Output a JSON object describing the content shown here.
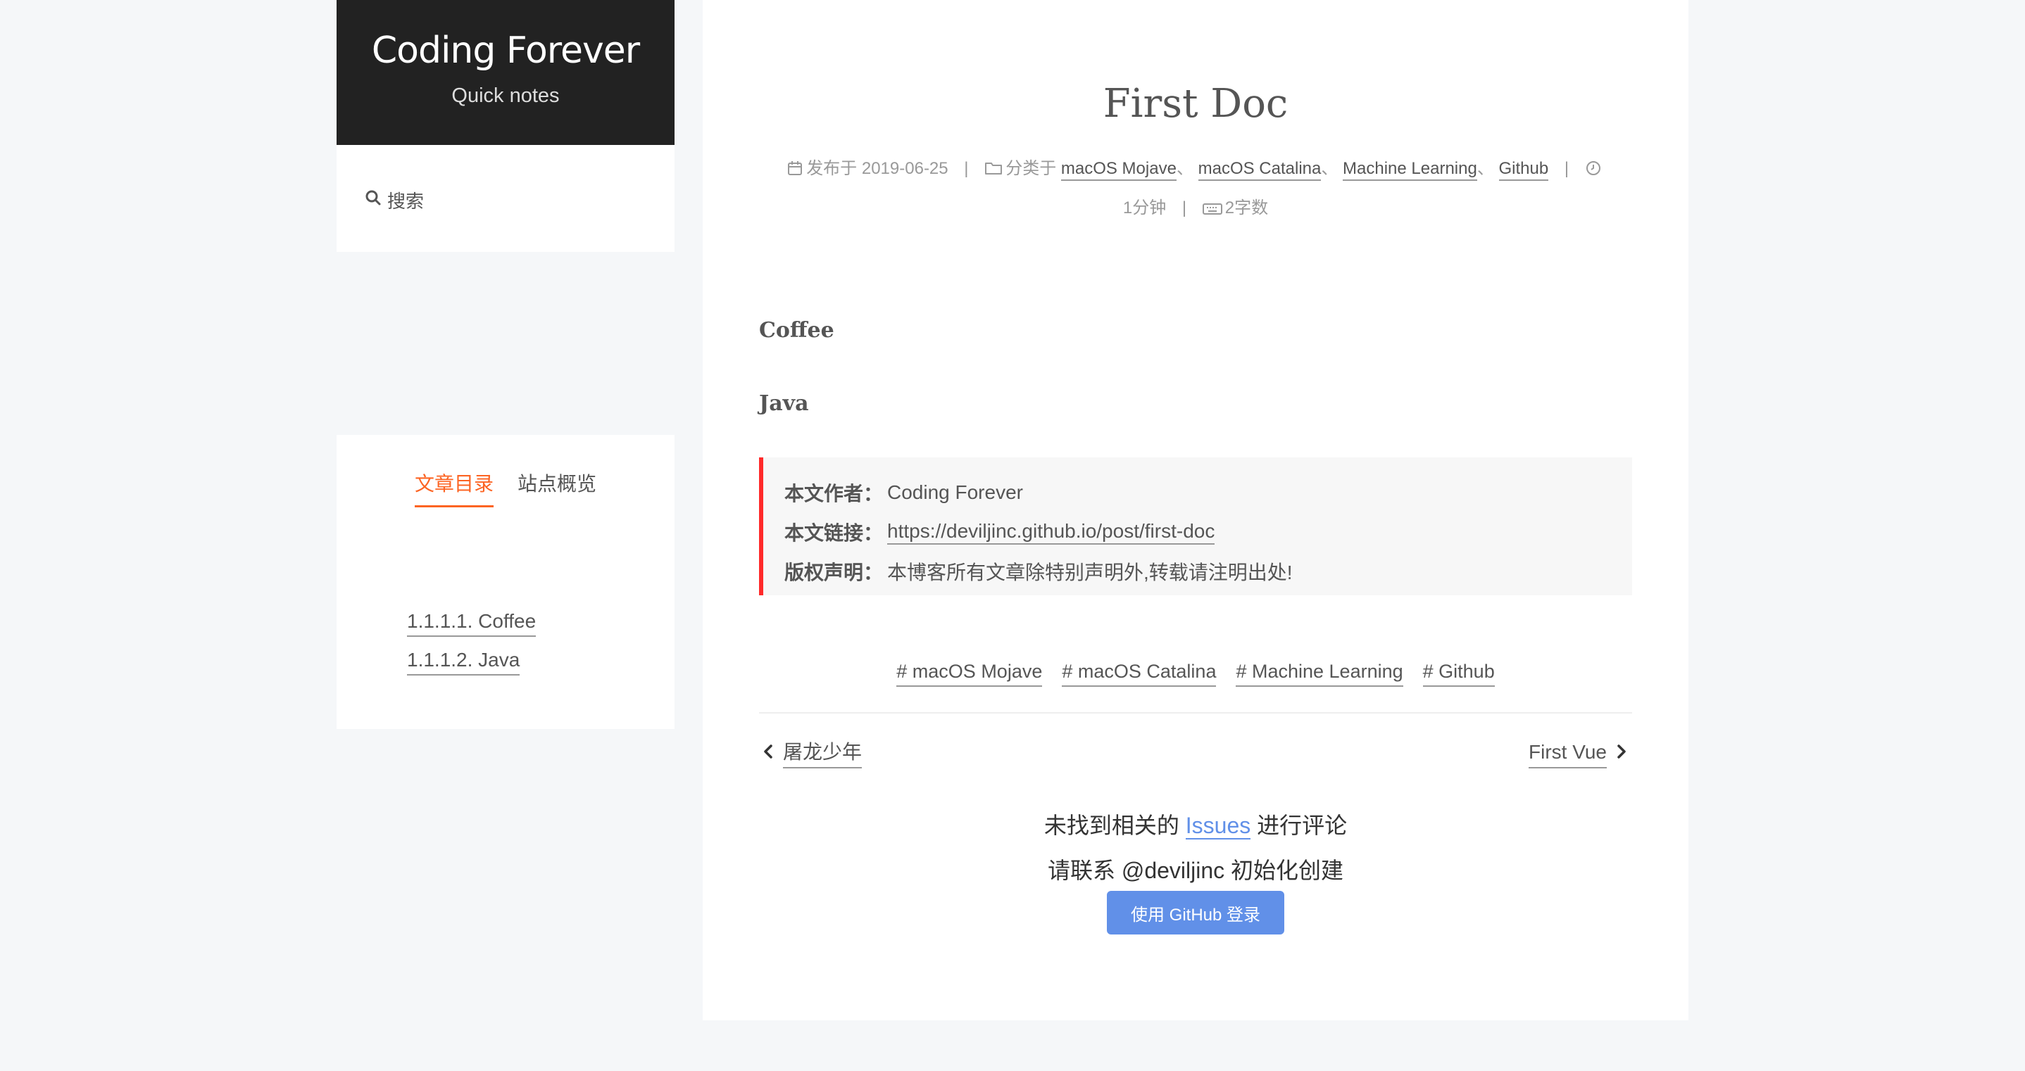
{
  "site": {
    "title": "Coding Forever",
    "subtitle": "Quick notes"
  },
  "sidebar": {
    "search_label": "搜索",
    "tabs": [
      {
        "label": "文章目录",
        "active": true
      },
      {
        "label": "站点概览",
        "active": false
      }
    ],
    "toc": [
      {
        "label": "1.1.1.1. Coffee"
      },
      {
        "label": "1.1.1.2. Java"
      }
    ]
  },
  "post": {
    "title": "First Doc",
    "meta": {
      "posted_prefix": "发布于",
      "posted_date": "2019-06-25",
      "category_prefix": "分类于",
      "categories": [
        "macOS Mojave",
        "macOS Catalina",
        "Machine Learning",
        "Github"
      ],
      "category_separator": "、",
      "reading_time": "1分钟",
      "word_count": "2字数",
      "separator": "|"
    },
    "headings": [
      "Coffee",
      "Java"
    ],
    "copyright": {
      "author_label": "本文作者：",
      "author": "Coding Forever",
      "link_label": "本文链接：",
      "link": "https://deviljinc.github.io/post/first-doc",
      "notice_label": "版权声明：",
      "notice": "本博客所有文章除特别声明外,转载请注明出处!"
    },
    "tags": [
      "# macOS Mojave",
      "# macOS Catalina",
      "# Machine Learning",
      "# Github"
    ],
    "prev": "屠龙少年",
    "next": "First Vue"
  },
  "comments": {
    "line1_before": "未找到相关的",
    "issues_link": "Issues",
    "line1_after": "进行评论",
    "line2": "请联系 @deviljinc 初始化创建",
    "login_button": "使用 GitHub 登录"
  },
  "colors": {
    "accent": "#fc6423",
    "copyright_border": "#ff2a2a",
    "gitalk_blue": "#6190e8",
    "header_bg": "#222222",
    "page_bg": "#f5f7f9"
  },
  "icons": [
    "search-icon",
    "calendar-icon",
    "folder-icon",
    "clock-icon",
    "keyboard-icon",
    "chevron-left-icon",
    "chevron-right-icon"
  ]
}
